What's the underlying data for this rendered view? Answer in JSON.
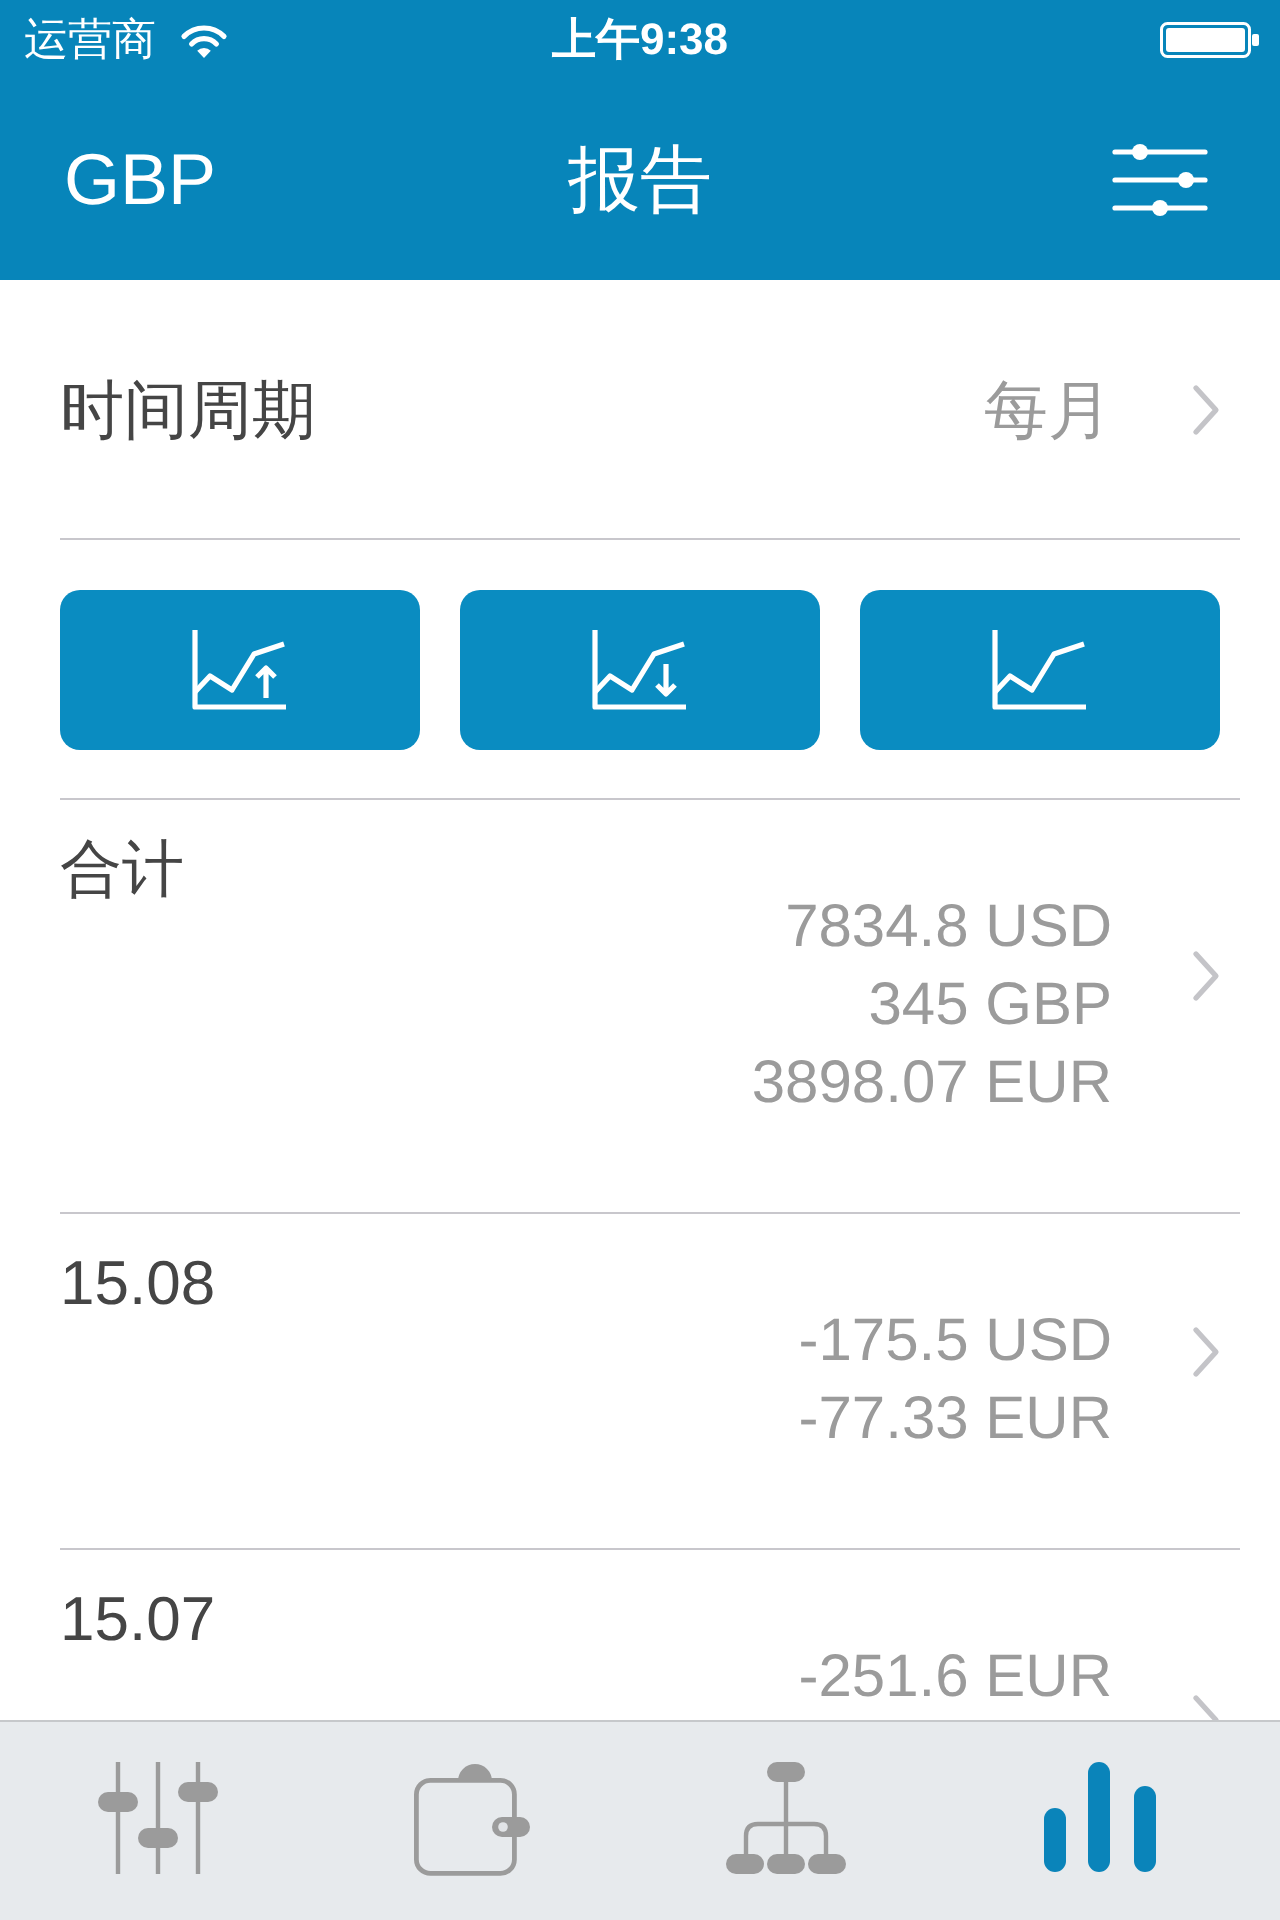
{
  "status_bar": {
    "carrier": "运营商",
    "time": "上午9:38"
  },
  "nav_bar": {
    "currency": "GBP",
    "title": "报告"
  },
  "period": {
    "label": "时间周期",
    "value": "每月"
  },
  "entries": [
    {
      "label": "合计",
      "amounts": [
        "7834.8 USD",
        "345 GBP",
        "3898.07 EUR"
      ]
    },
    {
      "label": "15.08",
      "amounts": [
        "-175.5 USD",
        "-77.33 EUR"
      ]
    },
    {
      "label": "15.07",
      "amounts": [
        "-251.6 EUR"
      ]
    }
  ],
  "tab_bar": {
    "tabs": [
      {
        "selected": false
      },
      {
        "selected": false
      },
      {
        "selected": false
      },
      {
        "selected": true
      }
    ]
  }
}
